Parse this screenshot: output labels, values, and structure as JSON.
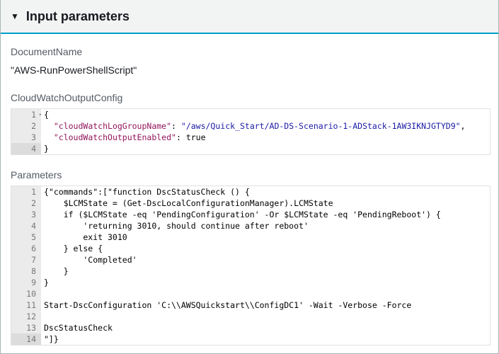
{
  "header": {
    "title": "Input parameters",
    "toggle_icon": "caret-down-icon"
  },
  "document_name": {
    "label": "DocumentName",
    "value": "\"AWS-RunPowerShellScript\""
  },
  "cloudwatch": {
    "label": "CloudWatchOutputConfig",
    "lines": [
      "{",
      "  \"cloudWatchLogGroupName\": \"/aws/Quick_Start/AD-DS-Scenario-1-ADStack-1AW3IKNJGTYD9\",",
      "  \"cloudWatchOutputEnabled\": true",
      "}"
    ],
    "key1": "\"cloudWatchLogGroupName\"",
    "val1": "\"/aws/Quick_Start/AD-DS-Scenario-1-ADStack-1AW3IKNJGTYD9\"",
    "key2": "\"cloudWatchOutputEnabled\"",
    "val2": "true"
  },
  "parameters": {
    "label": "Parameters",
    "lines": [
      "{\"commands\":[\"function DscStatusCheck () {",
      "    $LCMState = (Get-DscLocalConfigurationManager).LCMState",
      "    if ($LCMState -eq 'PendingConfiguration' -Or $LCMState -eq 'PendingReboot') {",
      "        'returning 3010, should continue after reboot'",
      "        exit 3010",
      "    } else {",
      "        'Completed'",
      "    }",
      "}",
      "",
      "Start-DscConfiguration 'C:\\\\AWSQuickstart\\\\ConfigDC1' -Wait -Verbose -Force",
      "",
      "DscStatusCheck",
      "\"]}"
    ]
  }
}
